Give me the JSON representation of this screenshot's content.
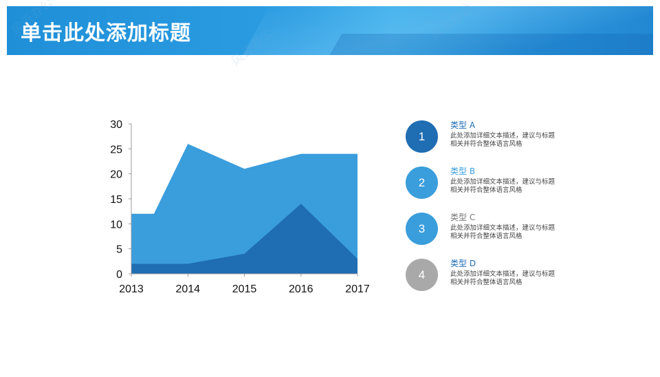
{
  "header": {
    "title": "单击此处添加标题",
    "watermark": "风云办公"
  },
  "colors": {
    "header": "#2290d8",
    "dark_blue": "#1f6db3",
    "mid_blue": "#3a9ddc",
    "gray": "#a9a9a9"
  },
  "chart_data": {
    "type": "area",
    "x": [
      2013,
      2013.4,
      2014,
      2015,
      2016,
      2017
    ],
    "x_ticks": [
      "2013",
      "2014",
      "2015",
      "2016",
      "2017"
    ],
    "y_ticks": [
      "0",
      "5",
      "10",
      "15",
      "20",
      "25",
      "30"
    ],
    "ylim": [
      0,
      30
    ],
    "series": [
      {
        "values": [
          12,
          12,
          26,
          21,
          24,
          24
        ],
        "color": "#3a9ddc"
      },
      {
        "values": [
          2,
          2,
          2,
          4,
          14,
          3
        ],
        "color": "#1f6db3"
      }
    ],
    "legend_position": "right"
  },
  "legend": [
    {
      "number": "1",
      "title": "类型 A",
      "desc": "此处添加详细文本描述，建议与标题相关并符合整体语言风格",
      "circle_color": "#1f6db3",
      "title_color": "#1f6db3"
    },
    {
      "number": "2",
      "title": "类型 B",
      "desc": "此处添加详细文本描述，建议与标题相关并符合整体语言风格",
      "circle_color": "#3a9ddc",
      "title_color": "#3a9ddc"
    },
    {
      "number": "3",
      "title": "类型 C",
      "desc": "此处添加详细文本描述，建议与标题相关并符合整体语言风格",
      "circle_color": "#3a9ddc",
      "title_color": "#777777"
    },
    {
      "number": "4",
      "title": "类型 D",
      "desc": "此处添加详细文本描述，建议与标题相关并符合整体语言风格",
      "circle_color": "#a9a9a9",
      "title_color": "#1f6db3"
    }
  ]
}
